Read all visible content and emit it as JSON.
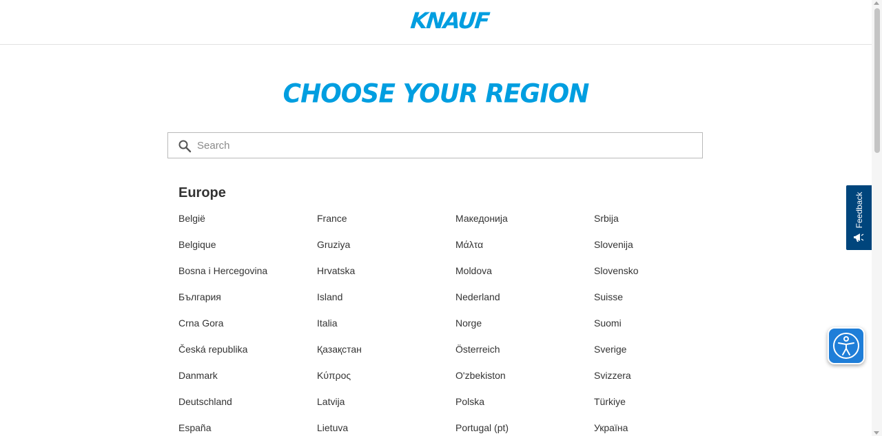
{
  "header": {
    "logo_text": "KNAUF"
  },
  "main": {
    "title": "CHOOSE YOUR REGION",
    "search": {
      "placeholder": "Search",
      "value": ""
    },
    "regions": [
      {
        "name": "Europe",
        "countries": [
          [
            "België",
            "France",
            "Македонија",
            "Srbija"
          ],
          [
            "Belgique",
            "Gruziya",
            "Μάλτα",
            "Slovenija"
          ],
          [
            "Bosna i Hercegovina",
            "Hrvatska",
            "Moldova",
            "Slovensko"
          ],
          [
            "България",
            "Island",
            "Nederland",
            "Suisse"
          ],
          [
            "Crna Gora",
            "Italia",
            "Norge",
            "Suomi"
          ],
          [
            "Česká republika",
            "Қазақстан",
            "Österreich",
            "Sverige"
          ],
          [
            "Danmark",
            "Κύπρος",
            "O'zbekiston",
            "Svizzera"
          ],
          [
            "Deutschland",
            "Latvija",
            "Polska",
            "Türkiye"
          ],
          [
            "España",
            "Lietuva",
            "Portugal (pt)",
            "Україна"
          ]
        ]
      }
    ]
  },
  "feedback": {
    "label": "Feedback"
  },
  "colors": {
    "brand": "#009ee0",
    "feedback_bg": "#00457c",
    "a11y_bg": "#1f7ed8"
  },
  "icons": {
    "search": "search-icon",
    "feedback": "megaphone-icon",
    "accessibility": "accessibility-icon"
  }
}
